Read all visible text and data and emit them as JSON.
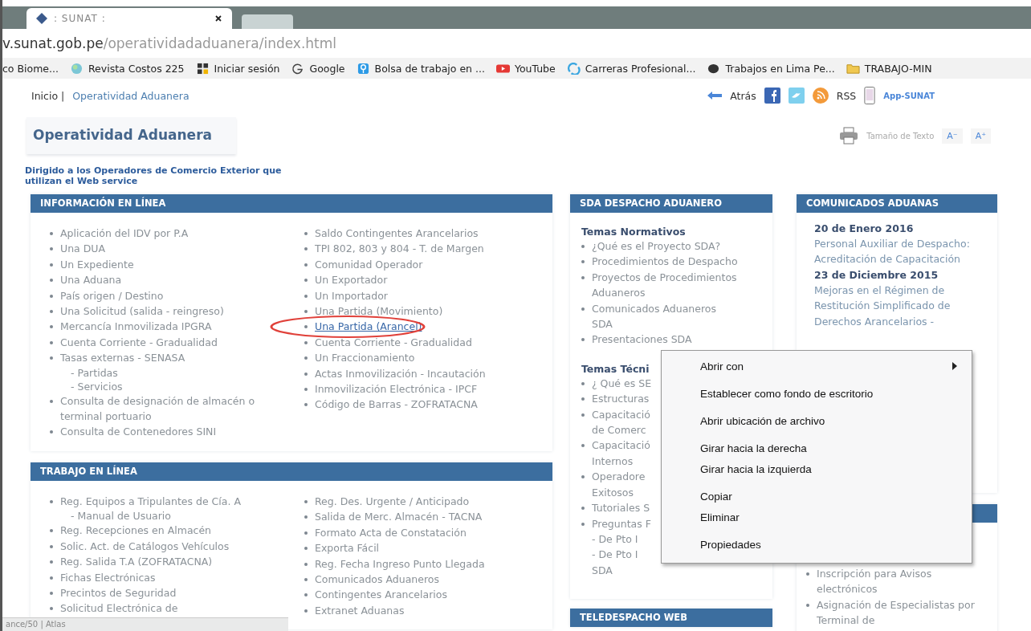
{
  "browser": {
    "tabs": [
      {
        "title": ": SUNAT :",
        "selected": true
      },
      {
        "selected": false
      }
    ],
    "address": {
      "host": "v.sunat.gob.pe",
      "path": "/operatividadaduanera/index.html"
    },
    "bookmarks": [
      {
        "label": "co Biome...",
        "kind": "none"
      },
      {
        "label": "Revista Costos 225",
        "kind": "globe"
      },
      {
        "label": "Iniciar sesión",
        "kind": "grid"
      },
      {
        "label": "Google",
        "kind": "google"
      },
      {
        "label": "Bolsa de trabajo en ...",
        "kind": "pin"
      },
      {
        "label": "YouTube",
        "kind": "youtube"
      },
      {
        "label": "Carreras Profesional...",
        "kind": "swirl"
      },
      {
        "label": "Trabajos en Lima Pe...",
        "kind": "blob"
      },
      {
        "label": "TRABAJO-MIN",
        "kind": "folder"
      }
    ]
  },
  "breadcrumb": {
    "home": "Inicio |",
    "current": "Operatividad Aduanera"
  },
  "toolbar": {
    "back": "Atrás",
    "rss": "RSS",
    "app": "App-SUNAT"
  },
  "title": "Operatividad Aduanera",
  "text_size": {
    "label": "Tamaño de Texto",
    "buttons": [
      "A⁻",
      "A⁺"
    ]
  },
  "subtitle": "Dirigido a los Operadores de Comercio Exterior que utilizan el Web service",
  "left_panels": [
    {
      "title": "INFORMACIÓN EN LÍNEA",
      "columns": [
        [
          {
            "text": "Aplicación del IDV por P.A"
          },
          {
            "text": "Una DUA"
          },
          {
            "text": "Un Expediente"
          },
          {
            "text": "Una Aduana"
          },
          {
            "text": "País origen / Destino"
          },
          {
            "text": "Una Solicitud (salida - reingreso)"
          },
          {
            "text": "Mercancía Inmovilizada IPGRA"
          },
          {
            "text": "Cuenta Corriente - Gradualidad"
          },
          {
            "text": "Tasas externas - SENASA",
            "children": [
              "- Partidas",
              "- Servicios"
            ]
          },
          {
            "text": "Consulta de designación de almacén o terminal portuario"
          },
          {
            "text": "Consulta de Contenedores SINI"
          }
        ],
        [
          {
            "text": "Saldo Contingentes Arancelarios"
          },
          {
            "text": "TPI 802, 803 y 804 - T. de Margen"
          },
          {
            "text": "Comunidad Operador"
          },
          {
            "text": "Un Exportador"
          },
          {
            "text": "Un Importador"
          },
          {
            "text": "Una Partida (Movimiento)"
          },
          {
            "text": "Una Partida (Arancel)",
            "link": true,
            "highlighted": true
          },
          {
            "text": "Cuenta Corriente - Gradualidad"
          },
          {
            "text": "Un Fraccionamiento"
          },
          {
            "text": "Actas Inmovilización - Incautación"
          },
          {
            "text": "Inmovilización Electrónica - IPCF"
          },
          {
            "text": "Código de Barras - ZOFRATACNA"
          }
        ]
      ]
    },
    {
      "title": "TRABAJO EN LÍNEA",
      "columns": [
        [
          {
            "text": "Reg. Equipos a Tripulantes de Cía. A",
            "children": [
              "- Manual de Usuario"
            ]
          },
          {
            "text": "Reg. Recepciones en Almacén"
          },
          {
            "text": "Solic. Act. de Catálogos Vehículos"
          },
          {
            "text": "Reg. Salida T.A (ZOFRATACNA)"
          },
          {
            "text": "Fichas Electrónicas"
          },
          {
            "text": "Precintos de Seguridad"
          },
          {
            "text": "Solicitud Electrónica de"
          }
        ],
        [
          {
            "text": "Reg. Des. Urgente / Anticipado"
          },
          {
            "text": "Salida de Merc. Almacén - TACNA"
          },
          {
            "text": "Formato Acta de Constatación"
          },
          {
            "text": "Exporta Fácil"
          },
          {
            "text": "Reg. Fecha Ingreso Punto Llegada"
          },
          {
            "text": "Comunicados Aduaneros"
          },
          {
            "text": "Contingentes Arancelarios"
          },
          {
            "text": "Extranet Aduanas"
          }
        ]
      ]
    }
  ],
  "sda_panel": {
    "title": "SDA DESPACHO ADUANERO",
    "sections": [
      {
        "heading": "Temas Normativos",
        "items": [
          {
            "text": "¿Qué es el Proyecto SDA?"
          },
          {
            "text": "Procedimientos de Despacho"
          },
          {
            "text": "Proyectos de Procedimientos",
            "children": [
              "Aduaneros"
            ]
          },
          {
            "text": "Comunicados Aduaneros",
            "children": [
              "SDA"
            ]
          },
          {
            "text": "Presentaciones SDA"
          }
        ]
      },
      {
        "heading": "Temas Técni",
        "items": [
          {
            "text": "¿ Qué es SE"
          },
          {
            "text": "Estructuras"
          },
          {
            "text": "Capacitació",
            "children": [
              "de Comerc"
            ]
          },
          {
            "text": "Capacitació",
            "children": [
              "Internos"
            ]
          },
          {
            "text": "Operadore",
            "children": [
              "Exitosos"
            ]
          },
          {
            "text": "Tutoriales S"
          },
          {
            "text": "Preguntas F",
            "children": [
              "- De Pto I",
              "- De Pto I",
              "SDA"
            ]
          }
        ]
      }
    ]
  },
  "teledespacho_panel": {
    "title": "TELEDESPACHO WEB"
  },
  "comunicados_panel": {
    "title": "COMUNICADOS ADUANAS",
    "entries": [
      {
        "date": "20 de Enero 2016",
        "text": "Personal Auxiliar de Despacho: Acreditación de Capacitación"
      },
      {
        "date": "23 de Diciembre 2015",
        "text": "Mejoras en el Régimen de Restitución Simplificado de Derechos Arancelarios -"
      }
    ]
  },
  "lower_right_panel": {
    "items": [
      "Inscripción para Avisos electrónicos",
      "Asignación de Especialistas por Terminal de"
    ]
  },
  "status_bar": "ance/50 | Atlas",
  "context_menu": {
    "groups": [
      [
        {
          "label": "Abrir con",
          "submenu": true
        }
      ],
      [
        {
          "label": "Establecer como fondo de escritorio",
          "submenu": false
        }
      ],
      [
        {
          "label": "Abrir ubicación de archivo",
          "submenu": false
        }
      ],
      [
        {
          "label": "Girar hacia la derecha",
          "submenu": false
        },
        {
          "label": "Girar hacia la izquierda",
          "submenu": false
        }
      ],
      [
        {
          "label": "Copiar",
          "submenu": false
        },
        {
          "label": "Eliminar",
          "submenu": false
        }
      ],
      [
        {
          "label": "Propiedades",
          "submenu": false
        }
      ]
    ]
  }
}
